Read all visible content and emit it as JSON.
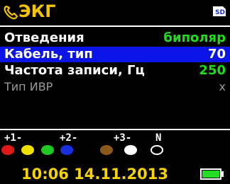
{
  "header": {
    "title": "ЭКГ",
    "phone_icon": "phone-icon",
    "sd_icon": "sd-card-icon",
    "sd_text": "SD",
    "title_color": "#f5c400"
  },
  "menu": {
    "items": [
      {
        "label": "Отведения",
        "value": "биполяр",
        "value_color": "#19e019",
        "selected": false,
        "enabled": true
      },
      {
        "label": "Кабель, тип",
        "value": "70",
        "value_color": "#ffffff",
        "selected": true,
        "enabled": true
      },
      {
        "label": "Частота записи, Гц",
        "value": "250",
        "value_color": "#19e019",
        "selected": false,
        "enabled": true
      },
      {
        "label": "Тип ИВР",
        "value": "x",
        "value_color": "#9a9a9a",
        "selected": false,
        "enabled": false
      }
    ],
    "selection_color": "#0a14e6"
  },
  "electrodes": {
    "labels": [
      "+1-",
      "+2-",
      "+3-",
      "N"
    ],
    "dots": [
      {
        "color": "#e01818",
        "name": "red"
      },
      {
        "color": "#f0e000",
        "name": "yellow"
      },
      {
        "color": "#22c822",
        "name": "green"
      },
      {
        "color": "#1830e0",
        "name": "blue"
      },
      {
        "color": "#8a5a18",
        "name": "brown"
      },
      {
        "color": "#ffffff",
        "name": "white"
      },
      {
        "color": "#000000",
        "name": "black"
      }
    ]
  },
  "footer": {
    "clock": "10:06 14.11.2013",
    "clock_color": "#f5d200",
    "battery_icon": "battery-icon",
    "battery_level": 1.0,
    "battery_color": "#22dd22"
  }
}
